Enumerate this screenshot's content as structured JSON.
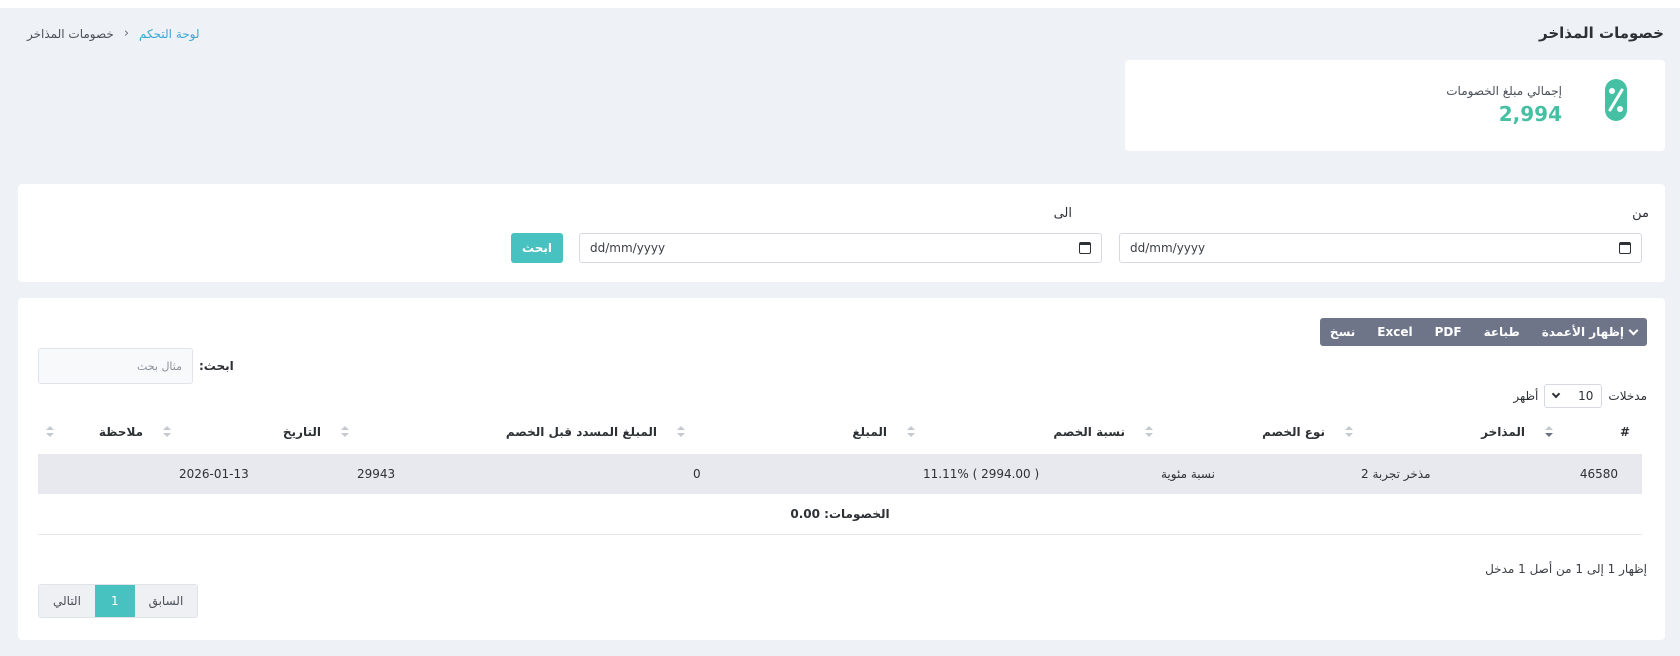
{
  "page": {
    "title": "خصومات المذاخر"
  },
  "breadcrumb": {
    "home": "لوحة التحكم",
    "separator": "›",
    "current": "خصومات المذاخر"
  },
  "summary": {
    "label": "إجمالي مبلغ الخصومات",
    "value": "2,994",
    "icon": "percent-icon",
    "accent": "#45c0a3"
  },
  "filter": {
    "from_label": "من",
    "to_label": "الى",
    "from_placeholder": "dd/mm/yyyy",
    "to_placeholder": "dd/mm/yyyy",
    "search_button": "ابحث",
    "button_color": "#47c2c0"
  },
  "toolbar": {
    "copy": "نسخ",
    "excel": "Excel",
    "pdf": "PDF",
    "print": "طباعة",
    "columns": "إظهار الأعمدة"
  },
  "search": {
    "label": "ابحث:",
    "placeholder": "مثال بحث"
  },
  "length": {
    "prefix": "أظهر",
    "value": "10",
    "suffix": "مدخلات"
  },
  "table": {
    "headers": [
      "#",
      "المذاخر",
      "نوع الخصم",
      "نسبة الخصم",
      "المبلغ",
      "المبلغ المسدد قبل الخصم",
      "التاريخ",
      "ملاحظة"
    ],
    "rows": [
      [
        "46580",
        "مذخر تجربة 2",
        "نسبة مئوية",
        "11.11% ( 2994.00 )",
        "0",
        "29943",
        "2026-01-13",
        ""
      ]
    ],
    "footer": "الخصومات: 0.00"
  },
  "pagination": {
    "info": "إظهار 1 إلى 1 من أصل 1 مدخل",
    "previous": "السابق",
    "page": "1",
    "next": "التالي"
  }
}
